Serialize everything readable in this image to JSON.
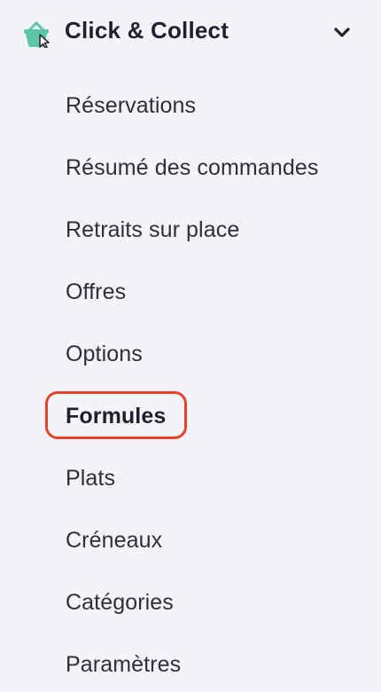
{
  "section": {
    "title": "Click & Collect",
    "icon": "shopping-basket-cursor-icon",
    "expand_icon": "chevron-down-icon",
    "accent_color": "#5cc7a8"
  },
  "menu": {
    "items": [
      {
        "label": "Réservations"
      },
      {
        "label": "Résumé des commandes"
      },
      {
        "label": "Retraits sur place"
      },
      {
        "label": "Offres"
      },
      {
        "label": "Options"
      },
      {
        "label": "Formules",
        "active": true
      },
      {
        "label": "Plats"
      },
      {
        "label": "Créneaux"
      },
      {
        "label": "Catégories"
      },
      {
        "label": "Paramètres"
      }
    ],
    "highlight_color": "#e2432d"
  }
}
